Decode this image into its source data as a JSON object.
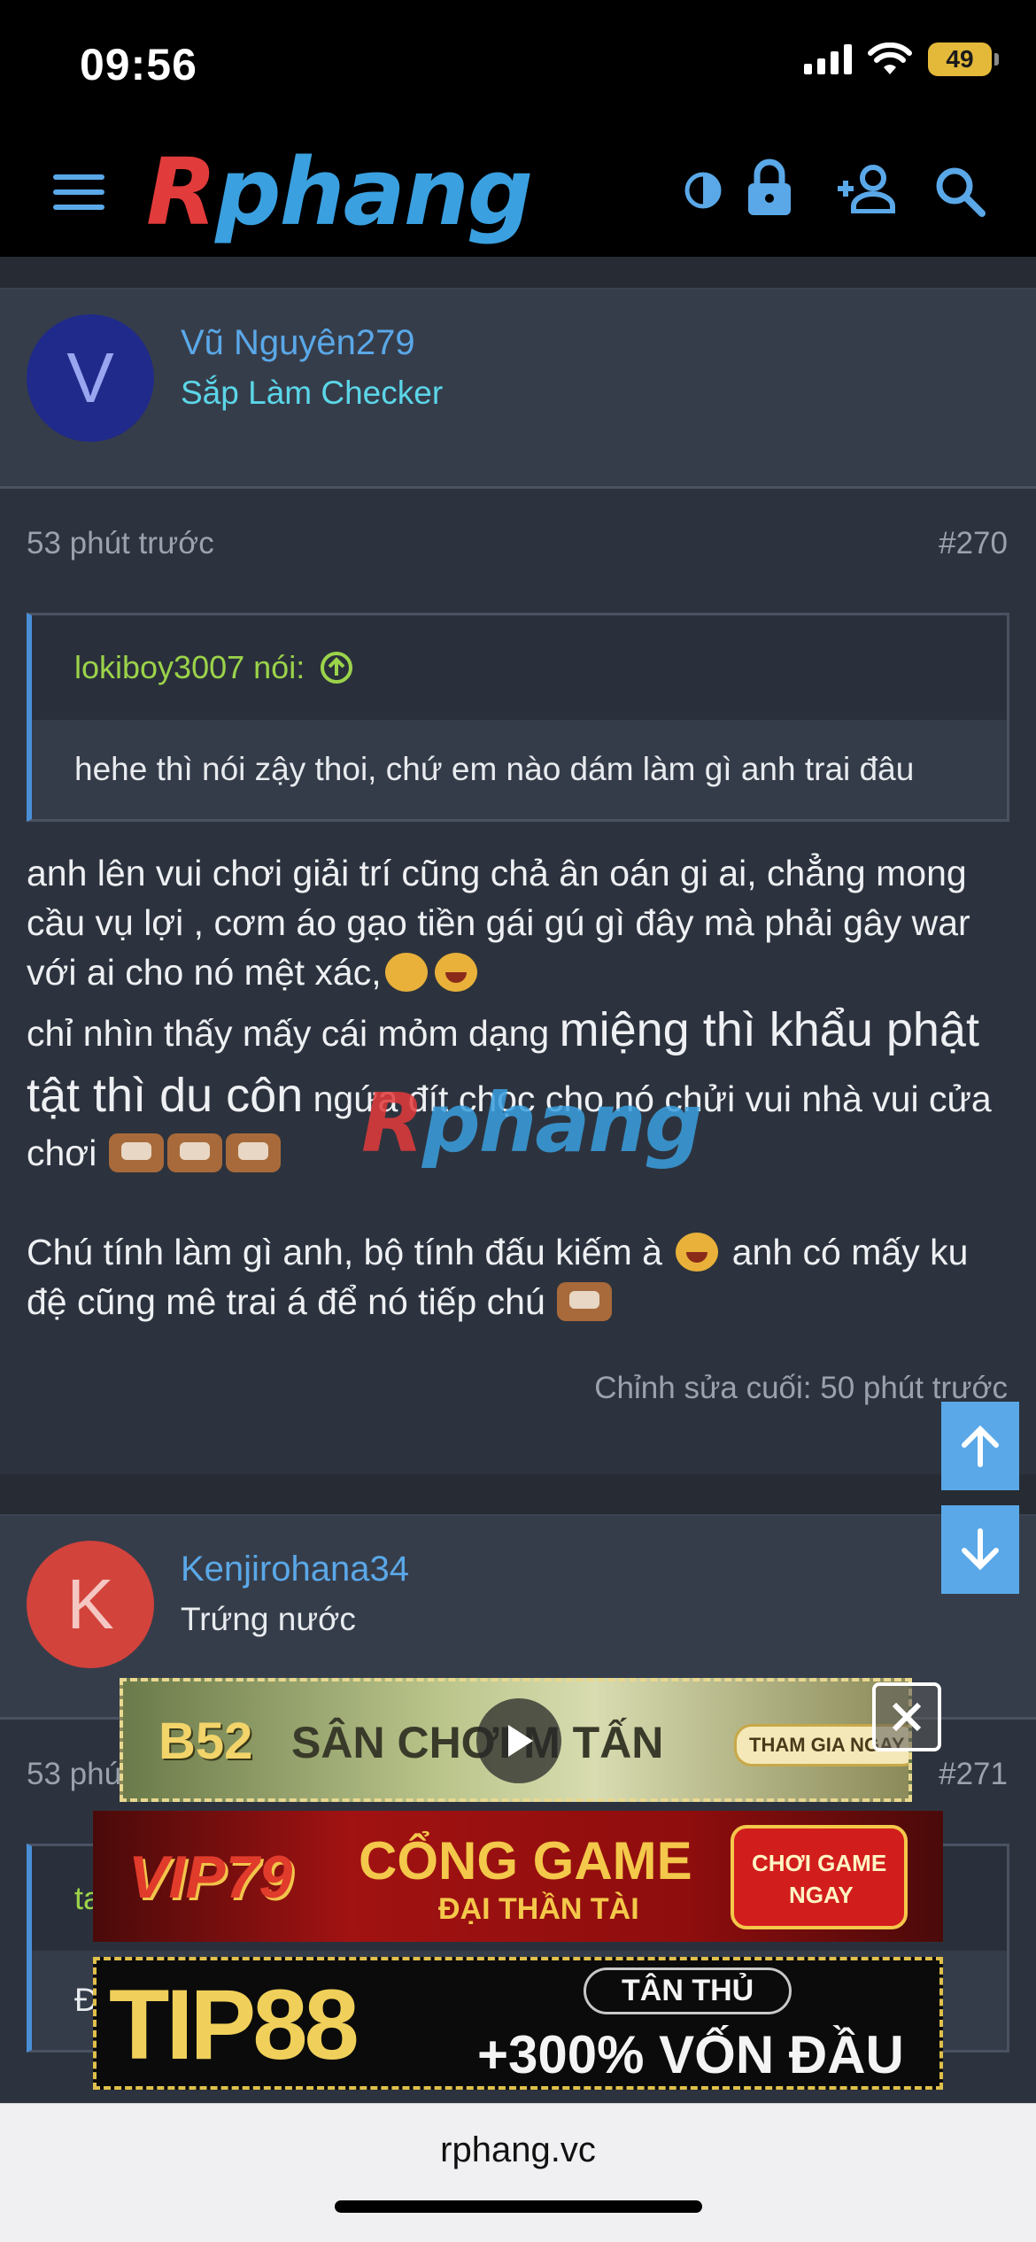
{
  "status_bar": {
    "time": "09:56",
    "battery": "49"
  },
  "header": {
    "logo": {
      "first": "R",
      "rest": "phang"
    }
  },
  "posts": [
    {
      "avatar_letter": "V",
      "avatar_color": "#1f2a8a",
      "username": "Vũ Nguyên279",
      "user_title": "Sắp Làm Checker",
      "user_title_color": "#5bd6e8",
      "time_ago": "53 phút trước",
      "post_number": "#270",
      "quote": {
        "author": "lokiboy3007 nói:",
        "text": "hehe thì nói zậy thoi, chứ em nào dám làm gì anh trai đâu"
      },
      "body": {
        "p1": "anh lên vui chơi giải trí cũng chả ân oán gi ai, chẳng mong cầu vụ lợi , cơm áo gạo tiền gái gú gì đây mà phải gây war với ai cho nó mệt xác,",
        "p2_start": "chỉ nhìn thấy mấy cái mỏm dạng ",
        "p2_big": "miệng thì khẩu phật tật thì du côn",
        "p2_end": " ngứa đít chọc cho nó chửi vui nhà vui cửa chơi",
        "p3_start": "Chú tính làm gì anh, bộ tính đấu kiếm à",
        "p3_mid": " anh có mấy ku đệ cũng mê trai á để nó tiếp chú"
      },
      "edited": "Chỉnh sửa cuối: 50 phút trước"
    },
    {
      "avatar_letter": "K",
      "avatar_color": "#d2433c",
      "username": "Kenjirohana34",
      "user_title": "Trứng nước",
      "time_ago_visible": "53 phú",
      "post_number": "#271",
      "quote_author_visible": "ta",
      "quote_text_visible": "Đ"
    }
  ],
  "watermark": {
    "first": "R",
    "rest": "phang"
  },
  "ads": {
    "b52": {
      "brand": "B52",
      "text": "SÂN CHƠI  M TẤN",
      "cta": "THAM GIA NGAY"
    },
    "vip79": {
      "brand": "VIP79",
      "line1": "CỔNG GAME",
      "line2": "ĐẠI THẦN TÀI",
      "cta_line1": "CHƠI GAME",
      "cta_line2": "NGAY"
    },
    "tip88": {
      "brand": "TIP88",
      "badge": "TÂN THỦ",
      "offer": "+300% VỐN ĐẦU"
    }
  },
  "browser": {
    "url": "rphang.vc"
  },
  "colors": {
    "accent": "#5aa8e8",
    "quote_author": "#9bd34a",
    "logo_red": "#e23b3b",
    "logo_blue": "#3aa0e0"
  },
  "icons": [
    "menu-icon",
    "contrast-icon",
    "lock-icon",
    "add-user-icon",
    "search-icon",
    "arrow-up-icon",
    "arrow-down-icon",
    "close-icon",
    "play-icon",
    "circle-arrow-up-icon"
  ]
}
